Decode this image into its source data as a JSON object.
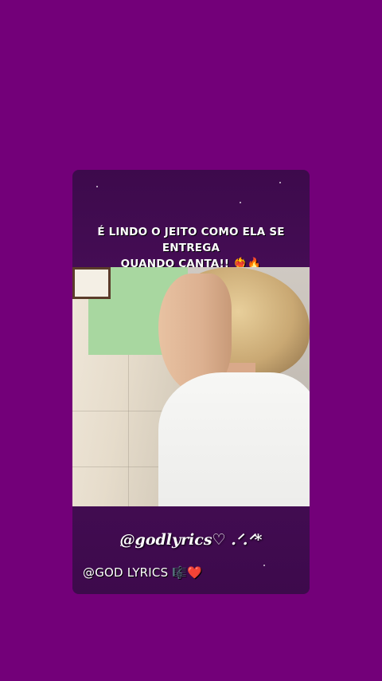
{
  "story": {
    "caption_line1": "É LINDO O JEITO COMO ELA SE ENTREGA",
    "caption_line2": "QUANDO CANTA!!",
    "caption_emojis": "❤️‍🔥🔥",
    "handle": "@godlyrics♡ .ᐟ.ᐟ*",
    "credit": "@GOD LYRICS 🎼❤️"
  },
  "colors": {
    "background": "#730079",
    "card": "#3d0a4c",
    "text": "#ffffff"
  }
}
